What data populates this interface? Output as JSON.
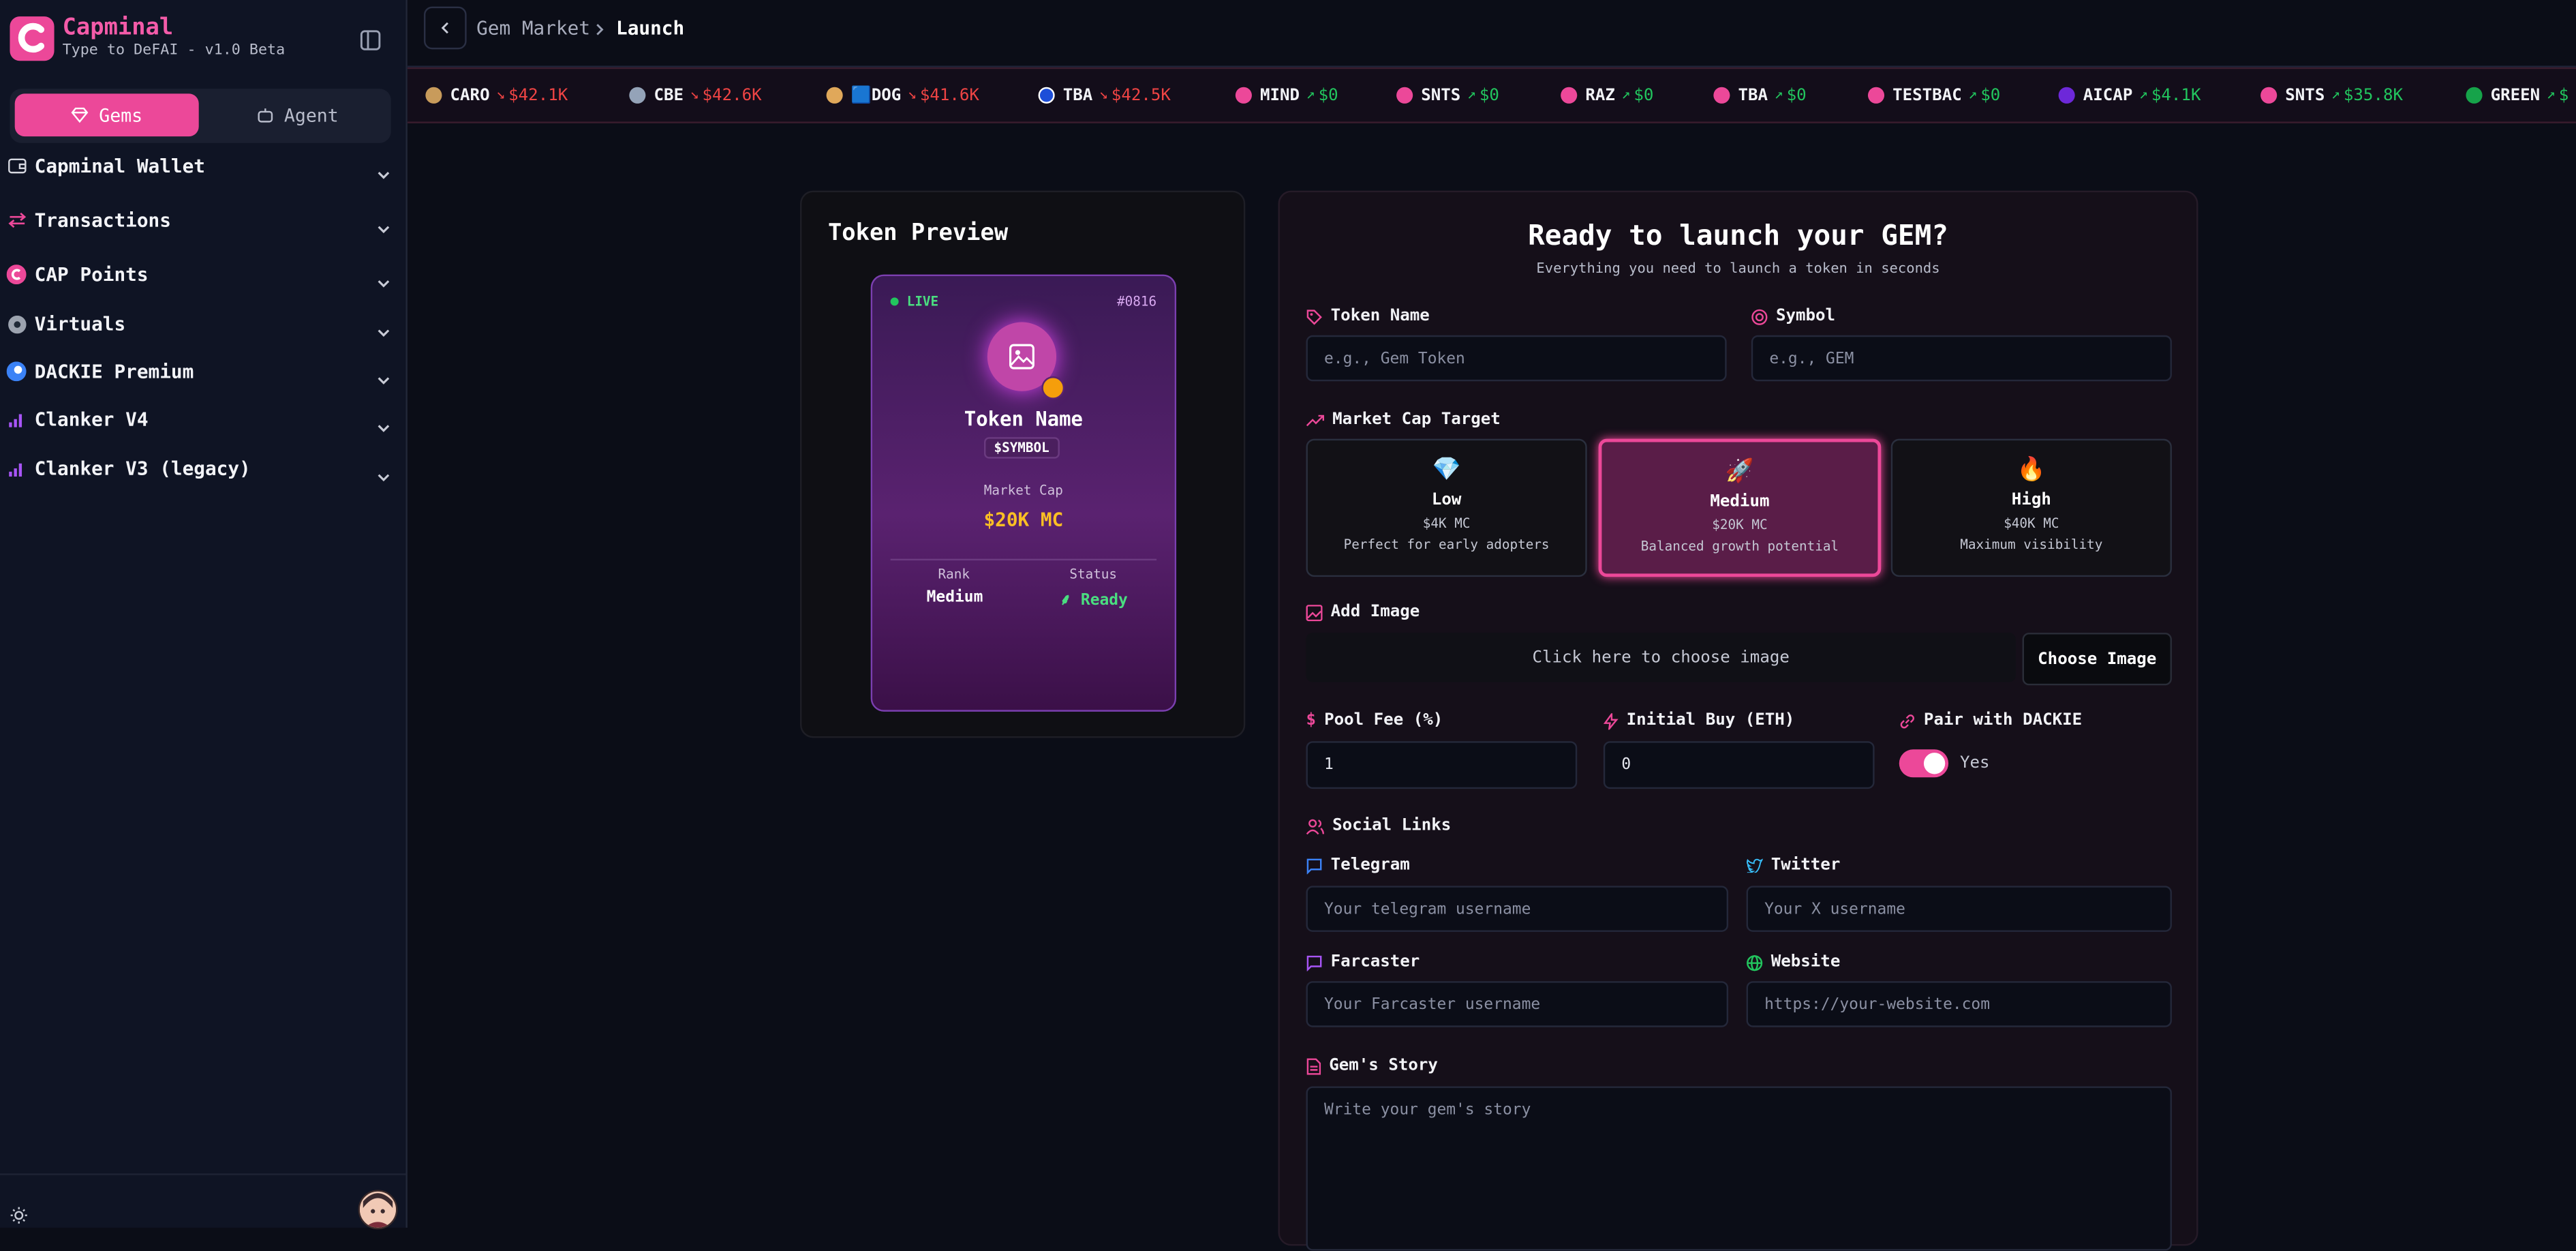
{
  "brand": {
    "name": "Capminal",
    "tagline": "Type to DeFAI - v1.0 Beta"
  },
  "modes": {
    "gems": "Gems",
    "agent": "Agent"
  },
  "sidebar": {
    "items": [
      {
        "label": "Capminal Wallet",
        "icon": "wallet-icon"
      },
      {
        "label": "Transactions",
        "icon": "transfer-icon"
      },
      {
        "label": "CAP Points",
        "icon": "cap-points-icon"
      },
      {
        "label": "Virtuals",
        "icon": "virtuals-icon"
      },
      {
        "label": "DACKIE Premium",
        "icon": "dackie-icon"
      },
      {
        "label": "Clanker V4",
        "icon": "bar-chart-icon"
      },
      {
        "label": "Clanker V3 (legacy)",
        "icon": "bar-chart-icon"
      }
    ]
  },
  "breadcrumb": {
    "parent": "Gem Market",
    "current": "Launch"
  },
  "ticker": [
    {
      "symbol": "CARO",
      "value": "$42.1K",
      "trend": "down"
    },
    {
      "symbol": "CBE",
      "value": "$42.6K",
      "trend": "down"
    },
    {
      "symbol": "🟦DOG",
      "value": "$41.6K",
      "trend": "down"
    },
    {
      "symbol": "TBA",
      "value": "$42.5K",
      "trend": "down"
    },
    {
      "symbol": "MIND",
      "value": "$0",
      "trend": "up"
    },
    {
      "symbol": "SNTS",
      "value": "$0",
      "trend": "up"
    },
    {
      "symbol": "RAZ",
      "value": "$0",
      "trend": "up"
    },
    {
      "symbol": "TBA",
      "value": "$0",
      "trend": "up"
    },
    {
      "symbol": "TESTBAC",
      "value": "$0",
      "trend": "up"
    },
    {
      "symbol": "AICAP",
      "value": "$4.1K",
      "trend": "up"
    },
    {
      "symbol": "SNTS",
      "value": "$35.8K",
      "trend": "up"
    },
    {
      "symbol": "GREEN",
      "value": "$",
      "trend": "up"
    }
  ],
  "preview": {
    "title": "Token Preview",
    "live": "LIVE",
    "card_id": "#0816",
    "token_name": "Token Name",
    "symbol": "$SYMBOL",
    "market_cap_label": "Market Cap",
    "market_cap_value": "$20K MC",
    "rank_label": "Rank",
    "rank_value": "Medium",
    "status_label": "Status",
    "status_value": "Ready"
  },
  "form": {
    "title": "Ready to launch your GEM?",
    "subtitle": "Everything you need to launch a token in seconds",
    "token_name_label": "Token Name",
    "token_name_placeholder": "e.g., Gem Token",
    "symbol_label": "Symbol",
    "symbol_placeholder": "e.g., GEM",
    "market_cap_label": "Market Cap Target",
    "tiers": [
      {
        "emoji": "💎",
        "name": "Low",
        "mc": "$4K MC",
        "desc": "Perfect for early adopters",
        "selected": false
      },
      {
        "emoji": "🚀",
        "name": "Medium",
        "mc": "$20K MC",
        "desc": "Balanced growth potential",
        "selected": true
      },
      {
        "emoji": "🔥",
        "name": "High",
        "mc": "$40K MC",
        "desc": "Maximum visibility",
        "selected": false
      }
    ],
    "add_image_label": "Add Image",
    "image_drop_text": "Click here to choose image",
    "choose_image_button": "Choose Image",
    "pool_fee_label": "Pool Fee (%)",
    "pool_fee_value": "1",
    "initial_buy_label": "Initial Buy (ETH)",
    "initial_buy_value": "0",
    "pair_label": "Pair with DACKIE",
    "pair_toggle_text": "Yes",
    "pair_enabled": true,
    "social_label": "Social Links",
    "telegram_label": "Telegram",
    "telegram_placeholder": "Your telegram username",
    "twitter_label": "Twitter",
    "twitter_placeholder": "Your X username",
    "farcaster_label": "Farcaster",
    "farcaster_placeholder": "Your Farcaster username",
    "website_label": "Website",
    "website_placeholder": "https://your-website.com",
    "story_label": "Gem's Story",
    "story_placeholder": "Write your gem's story"
  },
  "colors": {
    "accent": "#ec4899",
    "up": "#22c55e",
    "down": "#ef4444",
    "gold": "#fbbf24"
  }
}
